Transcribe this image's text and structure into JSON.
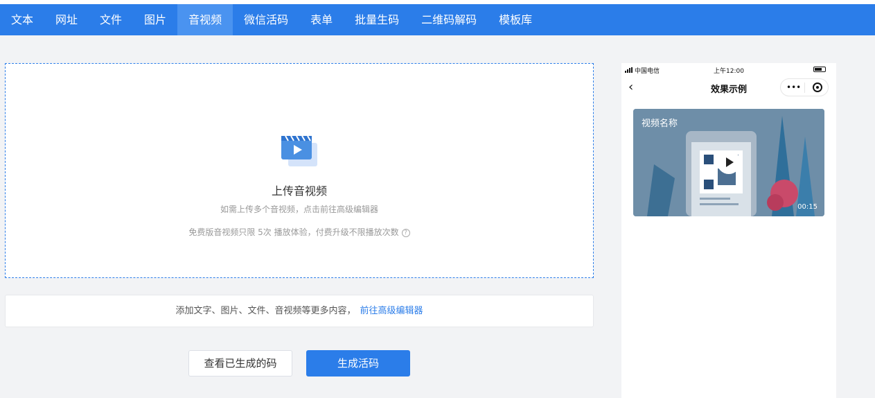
{
  "nav": {
    "tabs": [
      {
        "label": "文本"
      },
      {
        "label": "网址"
      },
      {
        "label": "文件"
      },
      {
        "label": "图片"
      },
      {
        "label": "音视频"
      },
      {
        "label": "微信活码"
      },
      {
        "label": "表单"
      },
      {
        "label": "批量生码"
      },
      {
        "label": "二维码解码"
      },
      {
        "label": "模板库"
      }
    ],
    "active_tab": "音视频"
  },
  "upload": {
    "icon": "video-clapper-icon",
    "title": "上传音视频",
    "hint": "如需上传多个音视频，点击前往高级编辑器",
    "free_notice": "免费版音视频只限 5次 播放体验，付费升级不限播放次数",
    "help_icon": "question-circle-icon",
    "help_glyph": "?"
  },
  "add_bar": {
    "text": "添加文字、图片、文件、音视频等更多内容，",
    "link": "前往高级编辑器"
  },
  "actions": {
    "view_label": "查看已生成的码",
    "generate_label": "生成活码"
  },
  "phone_preview": {
    "status": {
      "carrier": "中国电信",
      "time": "上午12:00"
    },
    "title": "效果示例",
    "back_glyph": "‹",
    "capsule_dots": "•••",
    "video": {
      "name": "视频名称",
      "duration": "00:15"
    }
  },
  "colors": {
    "primary": "#2b7de9",
    "nav_active": "#4a93f0",
    "page_bg": "#f2f3f5"
  }
}
